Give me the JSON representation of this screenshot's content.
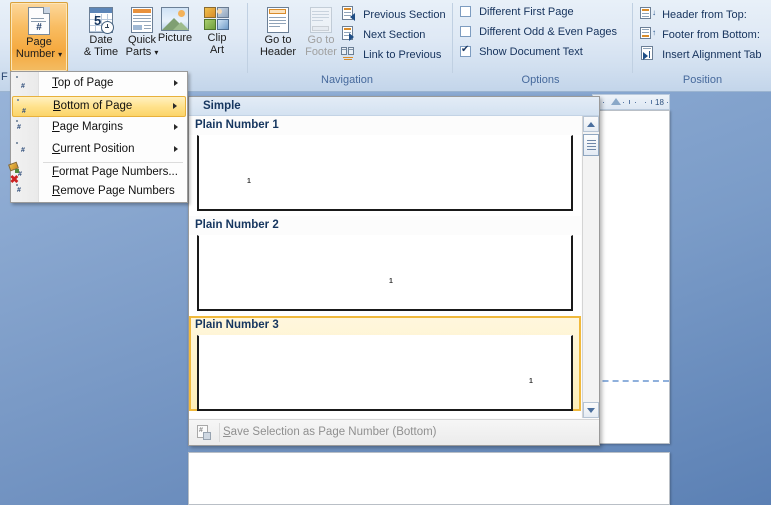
{
  "ribbon": {
    "groups": [
      {
        "label": ""
      },
      {
        "label": "Navigation"
      },
      {
        "label": "Options"
      },
      {
        "label": "Position"
      }
    ],
    "insert_group": {
      "page_number": {
        "label_line1": "Page",
        "label_line2": "Number",
        "icon": "page-number-icon",
        "state": "pressed",
        "has_dropdown": true
      },
      "date_time": {
        "label_line1": "Date",
        "label_line2": "& Time",
        "icon": "date-time-icon"
      },
      "quick_parts": {
        "label_line1": "Quick",
        "label_line2": "Parts",
        "icon": "quick-parts-icon",
        "has_dropdown": true
      },
      "picture": {
        "label_line1": "Picture",
        "label_line2": "",
        "icon": "picture-icon"
      },
      "clip_art": {
        "label_line1": "Clip",
        "label_line2": "Art",
        "icon": "clip-art-icon"
      }
    },
    "navigation_group": {
      "go_to_header": {
        "label_line1": "Go to",
        "label_line2": "Header",
        "icon": "go-to-header-icon",
        "enabled": true
      },
      "go_to_footer": {
        "label_line1": "Go to",
        "label_line2": "Footer",
        "icon": "go-to-footer-icon",
        "enabled": false
      },
      "previous_section": {
        "label": "Previous Section",
        "icon": "previous-section-icon"
      },
      "next_section": {
        "label": "Next Section",
        "icon": "next-section-icon"
      },
      "link_to_previous": {
        "label": "Link to Previous",
        "icon": "link-to-previous-icon"
      }
    },
    "options_group": {
      "different_first_page": {
        "label": "Different First Page",
        "checked": false
      },
      "different_odd_even": {
        "label": "Different Odd & Even Pages",
        "checked": false
      },
      "show_document_text": {
        "label": "Show Document Text",
        "checked": true
      }
    },
    "position_group": {
      "header_from_top": {
        "label": "Header from Top:",
        "icon": "header-from-top-icon"
      },
      "footer_from_bottom": {
        "label": "Footer from Bottom:",
        "icon": "footer-from-bottom-icon"
      },
      "insert_alignment_tab": {
        "label": "Insert Alignment Tab",
        "icon": "insert-alignment-tab-icon"
      }
    },
    "clipped_left_label": "F"
  },
  "page_number_menu": {
    "items": [
      {
        "label": "Top of Page",
        "accel": "T",
        "icon": "top-of-page-icon",
        "submenu": true,
        "highlighted": false
      },
      {
        "label": "Bottom of Page",
        "accel": "B",
        "icon": "bottom-of-page-icon",
        "submenu": true,
        "highlighted": true
      },
      {
        "label": "Page Margins",
        "accel": "P",
        "icon": "page-margins-icon",
        "submenu": true,
        "highlighted": false
      },
      {
        "label": "Current Position",
        "accel": "C",
        "icon": "current-position-icon",
        "submenu": true,
        "highlighted": false
      },
      {
        "label": "Format Page Numbers...",
        "accel": "F",
        "icon": "format-page-numbers-icon",
        "submenu": false,
        "highlighted": false
      },
      {
        "label": "Remove Page Numbers",
        "accel": "R",
        "icon": "remove-page-numbers-icon",
        "submenu": false,
        "highlighted": false
      }
    ]
  },
  "gallery": {
    "title": "Simple",
    "items": [
      {
        "label": "Plain Number 1",
        "number": "1",
        "align": "left",
        "selected": false
      },
      {
        "label": "Plain Number 2",
        "number": "1",
        "align": "center",
        "selected": false
      },
      {
        "label": "Plain Number 3",
        "number": "1",
        "align": "right",
        "selected": true
      }
    ],
    "footer": {
      "label": "Save Selection as Page Number (Bottom)",
      "accel": "S",
      "icon": "save-selection-icon",
      "enabled": false
    }
  },
  "ruler": {
    "number": "18",
    "unit_marker": "right-indent-marker"
  },
  "document": {
    "footer_boundary_visible": true
  }
}
